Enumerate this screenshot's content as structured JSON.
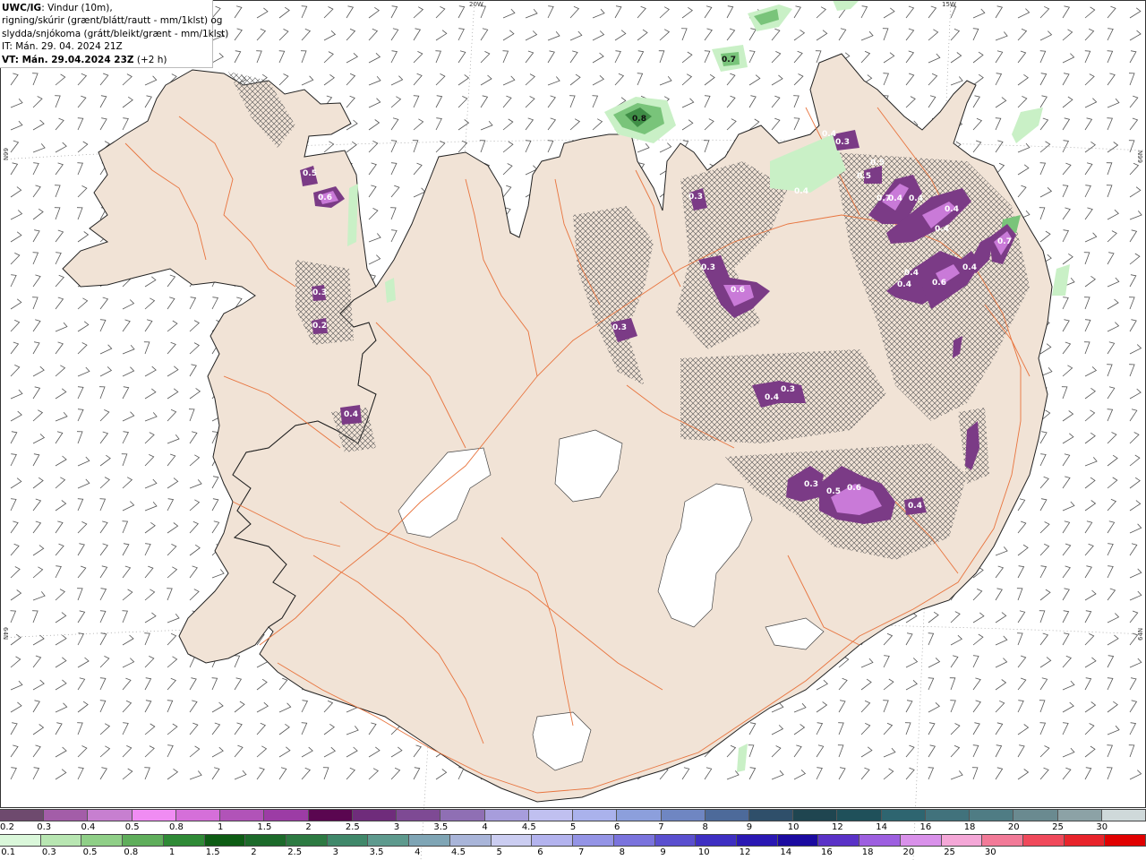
{
  "info": {
    "model": "UWC/IG",
    "line1_rest": ": Vindur (10m),",
    "line2": "rigning/skúrir (grænt/blátt/rautt - mm/1klst) og",
    "line3": "slydda/snjókoma (grátt/bleikt/grænt - mm/1klst)",
    "line4": "IT: Mán. 29. 04. 2024 21Z",
    "line5_bold": "VT: Mán. 29.04.2024 23Z",
    "line5_rest": " (+2 h)"
  },
  "grid_labels": {
    "top_20w": "20W",
    "top_15w": "15W",
    "left_66n": "66N",
    "right_66n": "66N",
    "left_64n": "64N",
    "right_64n": "64N"
  },
  "colors": {
    "land": "#f1e3d6",
    "coast": "#222222",
    "roads": "#e8743e",
    "glacier": "#ffffff",
    "snow_purple_dark": "#7b3b86",
    "snow_purple_light": "#c97ad8",
    "rain_green_light": "#c9f0c6",
    "rain_green_mid": "#79c47a",
    "rain_green_dark": "#3f8e46",
    "barb": "#555555"
  },
  "precip_labels": [
    {
      "text": "0.7"
    },
    {
      "text": "0.8"
    },
    {
      "text": "0.5"
    },
    {
      "text": "0.6"
    },
    {
      "text": "0.3"
    },
    {
      "text": "0.2"
    },
    {
      "text": "0.4"
    },
    {
      "text": "0.3"
    },
    {
      "text": "0.6"
    },
    {
      "text": "0.3"
    },
    {
      "text": "0.4"
    },
    {
      "text": "0.3"
    },
    {
      "text": "0.4"
    },
    {
      "text": "0.3"
    },
    {
      "text": "0.4"
    },
    {
      "text": "0.5"
    },
    {
      "text": "0.5"
    },
    {
      "text": "0.4"
    },
    {
      "text": "0.4"
    },
    {
      "text": "0.3"
    },
    {
      "text": "0.4"
    },
    {
      "text": "0.4"
    },
    {
      "text": "0.7"
    },
    {
      "text": "0.4"
    },
    {
      "text": "0.4"
    },
    {
      "text": "0.6"
    },
    {
      "text": "0.4"
    },
    {
      "text": "0.4"
    },
    {
      "text": "0.5"
    },
    {
      "text": "0.6"
    },
    {
      "text": "0.7"
    },
    {
      "text": "0.3"
    }
  ],
  "legend_snow": {
    "colors": [
      "#6e4a6e",
      "#a35da8",
      "#c77fd0",
      "#f08cf3",
      "#d56fd9",
      "#b153b8",
      "#9c3ca5",
      "#5a0650",
      "#6f2c7b",
      "#7e4a94",
      "#8f6fb4",
      "#a79ddc",
      "#c0c0f0",
      "#aab2ec",
      "#8c9fdc",
      "#6f86c2",
      "#4d6a9a",
      "#2f4f6a",
      "#1f4550",
      "#1f505a",
      "#2e6570",
      "#41727c",
      "#4f7c84",
      "#6a8a90",
      "#8ca2a6",
      "#cfd9da"
    ],
    "labels": [
      "0.2",
      "0.3",
      "0.4",
      "0.5",
      "0.8",
      "1",
      "1.5",
      "2",
      "2.5",
      "3",
      "3.5",
      "4",
      "4.5",
      "5",
      "6",
      "7",
      "8",
      "9",
      "10",
      "12",
      "14",
      "16",
      "18",
      "20",
      "25",
      "30"
    ]
  },
  "legend_rain": {
    "colors": [
      "#daf7da",
      "#b8e6b2",
      "#8fcf87",
      "#5fae5b",
      "#2f8a36",
      "#0d5c14",
      "#1c6a2a",
      "#2d7a42",
      "#40886a",
      "#5e9a8e",
      "#7fa5b5",
      "#a9b5d9",
      "#cbcdf1",
      "#b3b3ee",
      "#9494e6",
      "#7a73dd",
      "#5a4fcf",
      "#3e2fc2",
      "#2a18b3",
      "#1b0aa0",
      "#5a32c7",
      "#9d5fe0",
      "#d991ea",
      "#f4a7d7",
      "#f27a98",
      "#f0495b",
      "#e8242b",
      "#e00000"
    ],
    "labels": [
      "0.1",
      "0.3",
      "0.5",
      "0.8",
      "1",
      "1.5",
      "2",
      "2.5",
      "3",
      "3.5",
      "4",
      "4.5",
      "5",
      "6",
      "7",
      "8",
      "9",
      "10",
      "12",
      "14",
      "16",
      "18",
      "20",
      "25",
      "30"
    ]
  }
}
